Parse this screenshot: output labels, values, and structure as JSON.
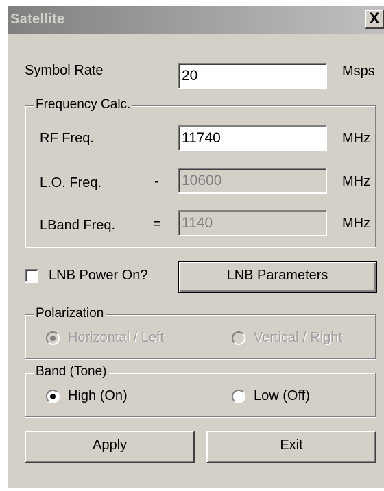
{
  "window": {
    "title": "Satellite",
    "close_glyph": "X"
  },
  "symbol_rate": {
    "label": "Symbol Rate",
    "value": "20",
    "unit": "Msps"
  },
  "frequency_calc": {
    "legend": "Frequency Calc.",
    "rf": {
      "label": "RF Freq.",
      "operator": "",
      "value": "11740",
      "unit": "MHz"
    },
    "lo": {
      "label": "L.O. Freq.",
      "operator": "-",
      "value": "10600",
      "unit": "MHz"
    },
    "lband": {
      "label": "LBand Freq.",
      "operator": "=",
      "value": "1140",
      "unit": "MHz"
    }
  },
  "lnb": {
    "power_label": "LNB Power On?",
    "power_checked": false,
    "parameters_button": "LNB Parameters"
  },
  "polarization": {
    "legend": "Polarization",
    "options": [
      {
        "label": "Horizontal / Left",
        "selected": true,
        "enabled": false
      },
      {
        "label": "Vertical / Right",
        "selected": false,
        "enabled": false
      }
    ]
  },
  "band": {
    "legend": "Band (Tone)",
    "options": [
      {
        "label": "High (On)",
        "selected": true,
        "enabled": true
      },
      {
        "label": "Low (Off)",
        "selected": false,
        "enabled": true
      }
    ]
  },
  "buttons": {
    "apply": "Apply",
    "exit": "Exit"
  }
}
